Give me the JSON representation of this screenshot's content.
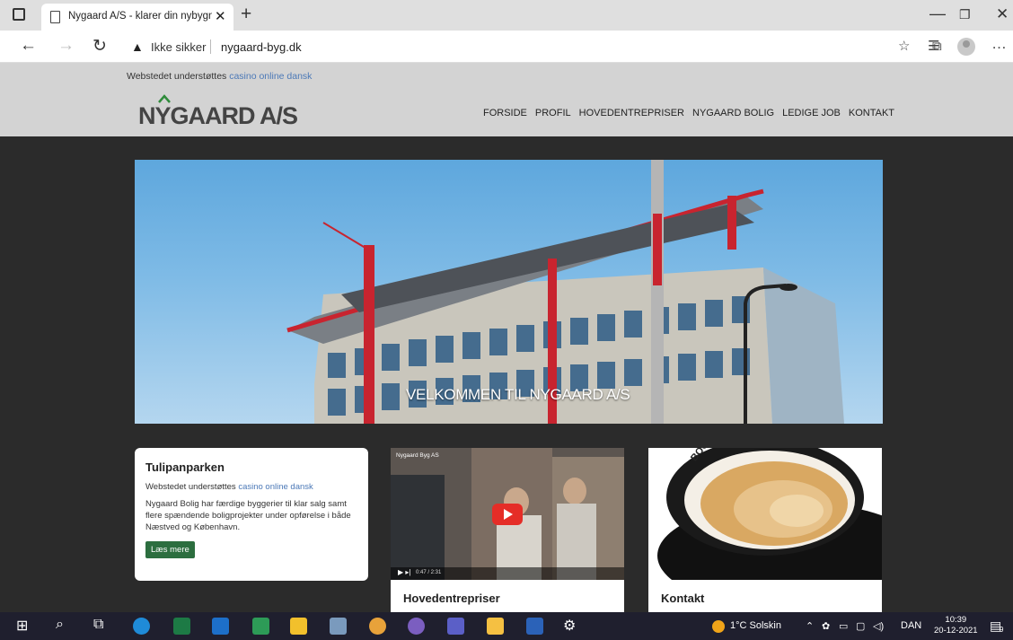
{
  "browser": {
    "tab_title": "Nygaard A/S - klarer din nybygni",
    "security_label": "Ikke sikker",
    "url": "nygaard-byg.dk"
  },
  "site": {
    "promo_prefix": "Webstedet understøttes",
    "promo_link": "casino online dansk",
    "logo": "NYGAARD A/S",
    "nav": [
      "FORSIDE",
      "PROFIL",
      "HOVEDENTREPRISER",
      "NYGAARD BOLIG",
      "LEDIGE JOB",
      "KONTAKT"
    ],
    "hero_caption": "VELKOMMEN TIL NYGAARD A/S"
  },
  "cards": {
    "tulip": {
      "title": "Tulipanparken",
      "promo_prefix": "Webstedet understøttes",
      "promo_link": "casino online dansk",
      "body": "Nygaard Bolig har færdige byggerier til klar salg samt flere spændende boligprojekter under opførelse i både Næstved og København.",
      "button": "Læs mere"
    },
    "video": {
      "channel": "Nygaard Byg AS",
      "time": "0:47 / 2:31",
      "title": "Hovedentrepriser"
    },
    "contact": {
      "image_text": "BOOK ET MØDE",
      "title": "Kontakt"
    }
  },
  "taskbar": {
    "weather": "1°C  Solskin",
    "language": "DAN",
    "time": "10:39",
    "date": "20-12-2021",
    "notifications": "9"
  },
  "colors": {
    "page_bg": "#2b2b2b",
    "header_bg": "#d3d3d3",
    "link": "#4c79b7",
    "button_green": "#2c6e3f",
    "logo_green": "#2e8b3a"
  }
}
